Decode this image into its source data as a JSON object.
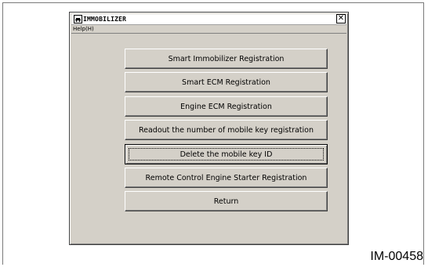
{
  "window": {
    "title": "IMMOBILIZER",
    "close_symbol": "✕",
    "app_icon": "car-key-icon"
  },
  "menu": {
    "help_label": "Help(H)"
  },
  "buttons": [
    {
      "label": "Smart Immobilizer Registration"
    },
    {
      "label": "Smart ECM Registration"
    },
    {
      "label": "Engine ECM Registration"
    },
    {
      "label": "Readout the number of mobile key registration"
    },
    {
      "label": "Delete the mobile key ID",
      "focused": true
    },
    {
      "label": "Remote Control Engine Starter Registration"
    },
    {
      "label": "Return"
    }
  ],
  "figure_id": "IM-00458",
  "colors": {
    "window_bg": "#d4d0c8",
    "titlebar_bg": "#ffffff"
  }
}
